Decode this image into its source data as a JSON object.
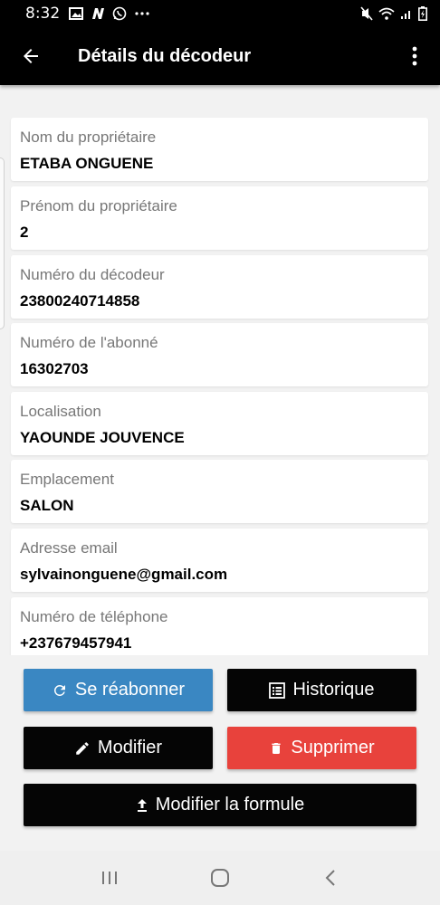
{
  "status": {
    "time": "8:32",
    "left_icons": [
      "gallery-icon",
      "n-app-icon",
      "whatsapp-icon",
      "more-dots"
    ],
    "right_icons": [
      "mute-icon",
      "wifi-icon",
      "signal-icon",
      "battery-icon"
    ]
  },
  "header": {
    "title": "Détails du décodeur",
    "back_icon": "arrow-left-icon",
    "menu_icon": "more-vertical-icon"
  },
  "fields": [
    {
      "label": "Nom du propriétaire",
      "value": "ETABA ONGUENE"
    },
    {
      "label": "Prénom du propriétaire",
      "value": "2"
    },
    {
      "label": "Numéro du décodeur",
      "value": "23800240714858"
    },
    {
      "label": "Numéro de l'abonné",
      "value": "16302703"
    },
    {
      "label": "Localisation",
      "value": "YAOUNDE JOUVENCE"
    },
    {
      "label": "Emplacement",
      "value": "SALON"
    },
    {
      "label": "Adresse email",
      "value": "sylvainonguene@gmail.com"
    },
    {
      "label": "Numéro de téléphone",
      "value": "+237679457941"
    }
  ],
  "actions": {
    "resubscribe": "Se réabonner",
    "history": "Historique",
    "edit": "Modifier",
    "delete": "Supprimer",
    "change_plan": "Modifier la formule"
  },
  "colors": {
    "resubscribe_bg": "#3a87c2",
    "delete_bg": "#e8423c",
    "dark_bg": "#050505"
  }
}
